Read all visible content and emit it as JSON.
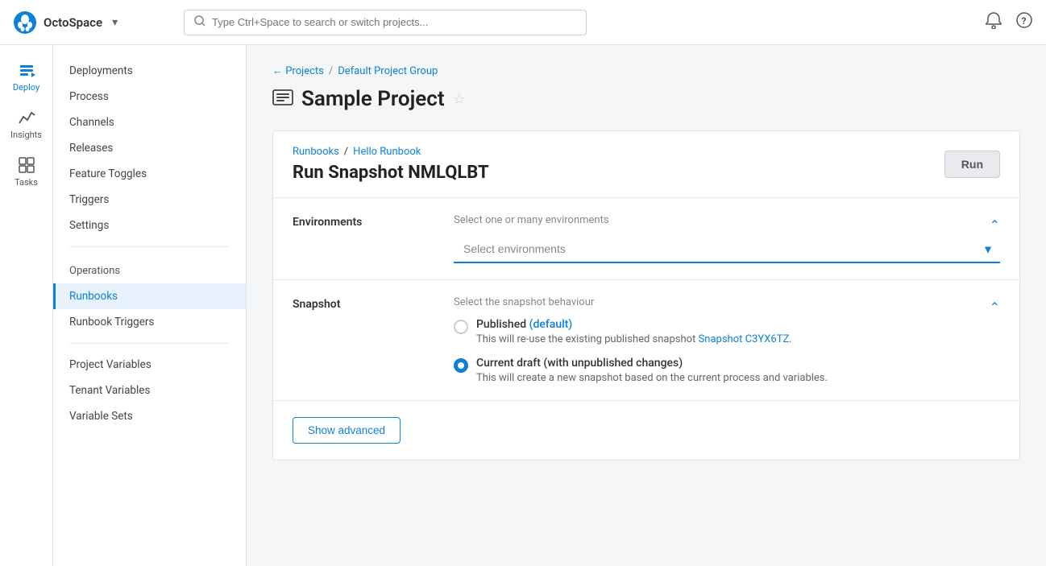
{
  "topbar": {
    "brand_name": "OctoSpace",
    "search_placeholder": "Type Ctrl+Space to search or switch projects...",
    "chevron": "▾"
  },
  "left_nav": {
    "items": [
      {
        "id": "deploy",
        "label": "Deploy",
        "active": true
      },
      {
        "id": "insights",
        "label": "Insights",
        "active": false
      },
      {
        "id": "tasks",
        "label": "Tasks",
        "active": false
      }
    ]
  },
  "sidebar": {
    "items": [
      {
        "id": "deployments",
        "label": "Deployments",
        "active": false,
        "section": false
      },
      {
        "id": "process",
        "label": "Process",
        "active": false,
        "section": false
      },
      {
        "id": "channels",
        "label": "Channels",
        "active": false,
        "section": false
      },
      {
        "id": "releases",
        "label": "Releases",
        "active": false,
        "section": false
      },
      {
        "id": "feature-toggles",
        "label": "Feature Toggles",
        "active": false,
        "section": false
      },
      {
        "id": "triggers",
        "label": "Triggers",
        "active": false,
        "section": false
      },
      {
        "id": "settings",
        "label": "Settings",
        "active": false,
        "section": false
      },
      {
        "id": "operations",
        "label": "Operations",
        "active": false,
        "section": true
      },
      {
        "id": "runbooks",
        "label": "Runbooks",
        "active": true,
        "section": false
      },
      {
        "id": "runbook-triggers",
        "label": "Runbook Triggers",
        "active": false,
        "section": false
      },
      {
        "id": "project-variables",
        "label": "Project Variables",
        "active": false,
        "section": true
      },
      {
        "id": "tenant-variables",
        "label": "Tenant Variables",
        "active": false,
        "section": false
      },
      {
        "id": "variable-sets",
        "label": "Variable Sets",
        "active": false,
        "section": false
      }
    ]
  },
  "breadcrumb": {
    "back_label": "← Projects",
    "separator": "/",
    "group_label": "Default Project Group"
  },
  "page": {
    "title": "Sample Project"
  },
  "run_card": {
    "breadcrumb_runbooks": "Runbooks",
    "breadcrumb_sep": "/",
    "breadcrumb_hello": "Hello Runbook",
    "title": "Run Snapshot NMLQLBT",
    "run_button": "Run"
  },
  "environments_section": {
    "label": "Environments",
    "subtitle": "Select one or many environments",
    "select_placeholder": "Select environments"
  },
  "snapshot_section": {
    "label": "Snapshot",
    "subtitle": "Select the snapshot behaviour",
    "options": [
      {
        "id": "published",
        "label": "Published",
        "badge": "(default)",
        "selected": false,
        "description": "This will re-use the existing published snapshot",
        "link_text": "Snapshot C3YX6TZ",
        "link_suffix": "."
      },
      {
        "id": "current-draft",
        "label": "Current draft (with unpublished changes)",
        "badge": "",
        "selected": true,
        "description": "This will create a new snapshot based on the current process and variables.",
        "link_text": "",
        "link_suffix": ""
      }
    ]
  },
  "advanced": {
    "button_label": "Show advanced"
  }
}
